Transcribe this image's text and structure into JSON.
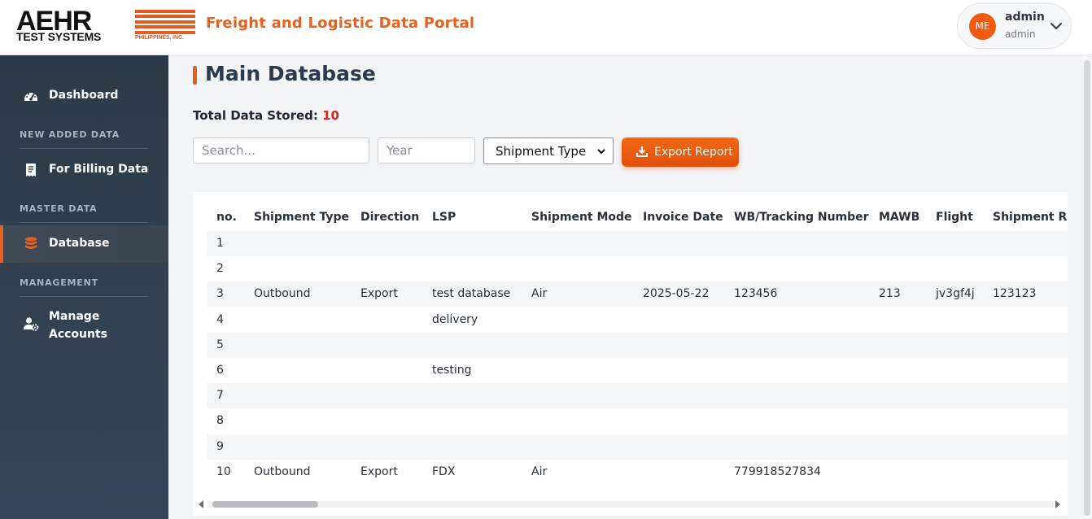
{
  "header": {
    "logo": {
      "main": "AEHR",
      "sub": "TEST SYSTEMS",
      "tag": "PHILIPPINES, INC."
    },
    "app_title": "Freight and Logistic Data Portal",
    "user": {
      "initials": "ME",
      "name": "admin",
      "role": "admin"
    }
  },
  "sidebar": {
    "dashboard": "Dashboard",
    "section_new": "NEW ADDED DATA",
    "billing": "For Billing Data",
    "section_master": "MASTER DATA",
    "database": "Database",
    "section_management": "MANAGEMENT",
    "manage_1": "Manage",
    "manage_2": "Accounts"
  },
  "main": {
    "title": "Main Database",
    "total_label": "Total Data Stored:",
    "total_count": "10",
    "search_placeholder": "Search...",
    "year_placeholder": "Year",
    "shipment_type_select": "Shipment Type",
    "export_label": "Export Report"
  },
  "table": {
    "headers": [
      "no.",
      "Shipment Type",
      "Direction",
      "LSP",
      "Shipment Mode",
      "Invoice Date",
      "WB/Tracking Number",
      "MAWB",
      "Flight",
      "Shipment Ref"
    ],
    "rows": [
      [
        "1",
        "",
        "",
        "",
        "",
        "",
        "",
        "",
        "",
        ""
      ],
      [
        "2",
        "",
        "",
        "",
        "",
        "",
        "",
        "",
        "",
        ""
      ],
      [
        "3",
        "Outbound",
        "Export",
        "test database",
        "Air",
        "2025-05-22",
        "123456",
        "213",
        "jv3gf4j",
        "123123"
      ],
      [
        "4",
        "",
        "",
        "delivery",
        "",
        "",
        "",
        "",
        "",
        ""
      ],
      [
        "5",
        "",
        "",
        "",
        "",
        "",
        "",
        "",
        "",
        ""
      ],
      [
        "6",
        "",
        "",
        "testing",
        "",
        "",
        "",
        "",
        "",
        ""
      ],
      [
        "7",
        "",
        "",
        "",
        "",
        "",
        "",
        "",
        "",
        ""
      ],
      [
        "8",
        "",
        "",
        "",
        "",
        "",
        "",
        "",
        "",
        ""
      ],
      [
        "9",
        "",
        "",
        "",
        "",
        "",
        "",
        "",
        "",
        ""
      ],
      [
        "10",
        "Outbound",
        "Export",
        "FDX",
        "Air",
        "",
        "779918527834",
        "",
        "",
        ""
      ]
    ]
  },
  "colors": {
    "accent": "#e8601f",
    "sidebar_bg": "#2c3a48",
    "count_red": "#e0201a"
  },
  "icons": {
    "dashboard": "speedometer-icon",
    "billing": "receipt-icon",
    "database": "database-icon",
    "manage": "user-gear-icon",
    "export": "download-icon",
    "user_menu": "chevron-down-icon"
  }
}
